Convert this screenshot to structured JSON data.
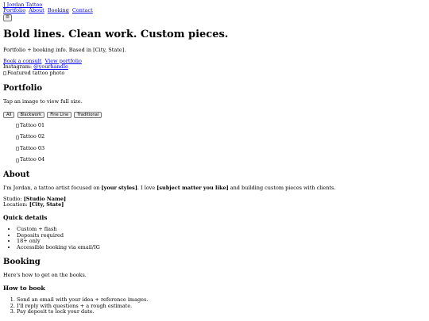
{
  "header": {
    "brand": "J Jordan Tattoo",
    "nav": [
      "Portfolio",
      "About",
      "Booking",
      "Contact"
    ],
    "menu_button": "☰"
  },
  "hero": {
    "title": "Bold lines. Clean work. Custom pieces.",
    "subtitle": "Portfolio + booking info. Based in [City, State].",
    "cta_primary": "Book a consult",
    "cta_secondary": "View portfolio",
    "instagram_label": "Instagram:",
    "instagram_handle": "@yourhandle",
    "featured_alt": "Featured tattoo photo"
  },
  "portfolio": {
    "heading": "Portfolio",
    "hint": "Tap an image to view full size.",
    "filters": [
      "All",
      "Blackwork",
      "Fine Line",
      "Traditional"
    ],
    "items": [
      "Tattoo 01",
      "Tattoo 02",
      "Tattoo 03",
      "Tattoo 04"
    ]
  },
  "about": {
    "heading": "About",
    "text_1": "I'm Jordan, a tattoo artist focused on ",
    "styles": "[your styles]",
    "text_2": ". I love ",
    "subject": "[subject matter you like]",
    "text_3": " and building custom pieces with clients.",
    "studio_label": "Studio:",
    "studio_value": "[Studio Name]",
    "location_label": "Location:",
    "location_value": "[City, State]",
    "quick_heading": "Quick details",
    "quick_items": [
      "Custom + flash",
      "Deposits required",
      "18+ only",
      "Accessible booking via email/IG"
    ]
  },
  "booking": {
    "heading": "Booking",
    "intro": "Here's how to get on the books.",
    "howto_heading": "How to book",
    "steps": [
      "Send an email with your idea + reference images.",
      "I'll reply with questions + a rough estimate.",
      "Pay deposit to lock your date."
    ]
  }
}
